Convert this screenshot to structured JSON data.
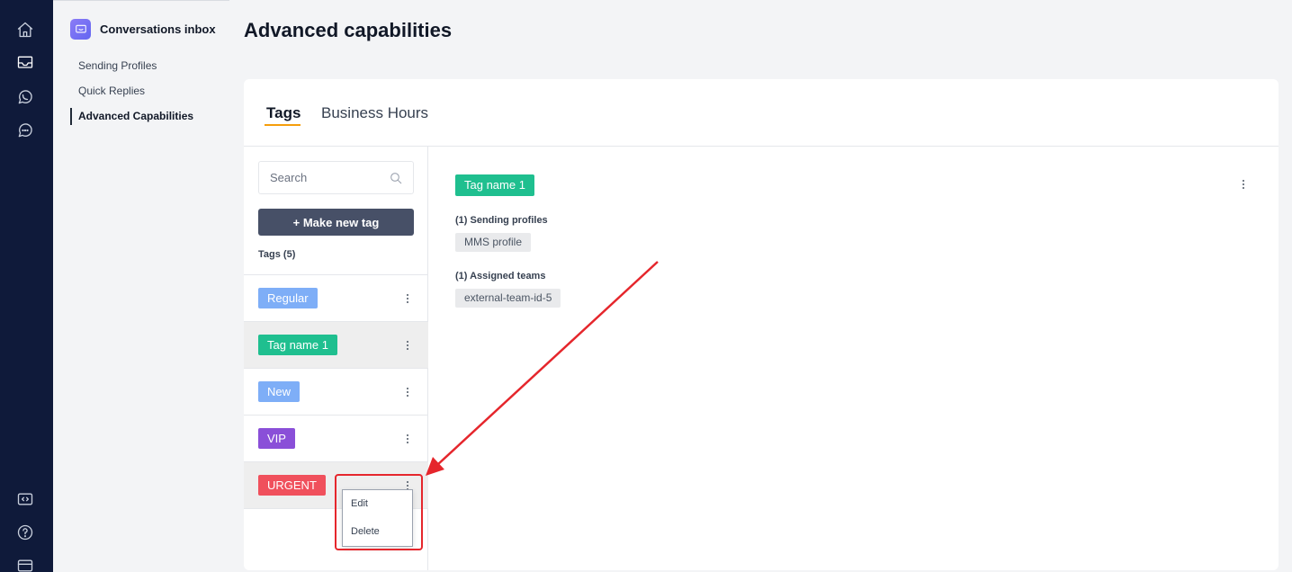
{
  "rail": {
    "top_icons": [
      "home-icon",
      "inbox-icon",
      "whatsapp-icon",
      "chat-bubble-icon"
    ],
    "bottom_icons": [
      "code-icon",
      "help-icon",
      "billing-card-icon"
    ]
  },
  "sidebar": {
    "title": "Conversations inbox",
    "items": [
      {
        "label": "Sending Profiles"
      },
      {
        "label": "Quick Replies"
      },
      {
        "label": "Advanced Capabilities",
        "active": true
      }
    ]
  },
  "page_title": "Advanced capabilities",
  "tabs": [
    {
      "label": "Tags",
      "active": true
    },
    {
      "label": "Business Hours",
      "active": false
    }
  ],
  "tag_list": {
    "search_placeholder": "Search",
    "new_tag_label": "+ Make new tag",
    "count_label": "Tags (5)",
    "tags": [
      {
        "label": "Regular",
        "color": "#7eaef7"
      },
      {
        "label": "Tag name 1",
        "color": "#1fbf8f",
        "selected": true
      },
      {
        "label": "New",
        "color": "#7eaef7"
      },
      {
        "label": "VIP",
        "color": "#8a4fd8"
      },
      {
        "label": "URGENT",
        "color": "#f0505c"
      }
    ]
  },
  "context_menu": {
    "items": [
      {
        "label": "Edit"
      },
      {
        "label": "Delete"
      }
    ]
  },
  "detail": {
    "tag_label": "Tag name 1",
    "tag_color": "#1fbf8f",
    "sending_profiles_label": "(1) Sending profiles",
    "sending_profiles": [
      "MMS profile"
    ],
    "assigned_teams_label": "(1) Assigned teams",
    "assigned_teams": [
      "external-team-id-5"
    ]
  },
  "colors": {
    "rail_bg": "#0f1a3a",
    "accent_tab": "#f59e0b",
    "button_bg": "#475067",
    "annotation_red": "#e5262c"
  }
}
